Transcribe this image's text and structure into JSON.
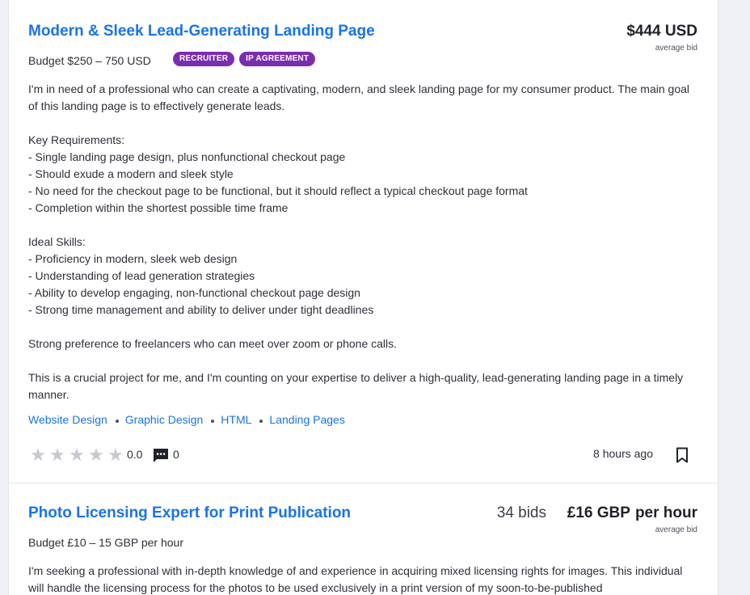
{
  "projects": [
    {
      "title": "Modern & Sleek Lead-Generating Landing Page",
      "price_amount": "$444 USD",
      "price_unit": "",
      "price_caption": "average bid",
      "bids": "",
      "budget": "Budget $250 – 750 USD",
      "tags": [
        "RECRUITER",
        "IP AGREEMENT"
      ],
      "tag_color": "#7b2db0",
      "description": "I'm in need of a professional who can create a captivating, modern, and sleek landing page for my consumer product. The main goal of this landing page is to effectively generate leads.\n\nKey Requirements:\n- Single landing page design, plus nonfunctional checkout page\n- Should exude a modern and sleek style\n- No need for the checkout page to be functional, but it should reflect a typical checkout page format\n- Completion within the shortest possible time frame\n\nIdeal Skills:\n- Proficiency in modern, sleek web design\n- Understanding of lead generation strategies\n- Ability to develop engaging, non-functional checkout page design\n- Strong time management and ability to deliver under tight deadlines\n\nStrong preference to freelancers who can meet over zoom or phone calls.\n\nThis is a crucial project for me, and I'm counting on your expertise to deliver a high-quality, lead-generating landing page in a timely manner.",
      "skills": [
        "Website Design",
        "Graphic Design",
        "HTML",
        "Landing Pages"
      ],
      "rating": "0.0",
      "star_count": 5,
      "reviews": "0",
      "posted": "8 hours ago",
      "icons": {
        "rating": "star-icon",
        "reviews": "chat-bubble-icon",
        "save": "bookmark-icon"
      }
    },
    {
      "title": "Photo Licensing Expert for Print Publication",
      "bids": "34 bids",
      "price_amount": "£16 GBP",
      "price_unit": "per hour",
      "price_caption": "average bid",
      "budget": "Budget £10 – 15 GBP per hour",
      "description": "I'm seeking a professional with in-depth knowledge of and experience in acquiring mixed licensing rights for images. This individual will handle the licensing process for the photos to be used exclusively in a print version of my soon-to-be-published"
    }
  ],
  "colors": {
    "link": "#1a73e8",
    "text": "#2c3038",
    "star_empty": "#c6c9cf",
    "background": "#eef0f3"
  }
}
